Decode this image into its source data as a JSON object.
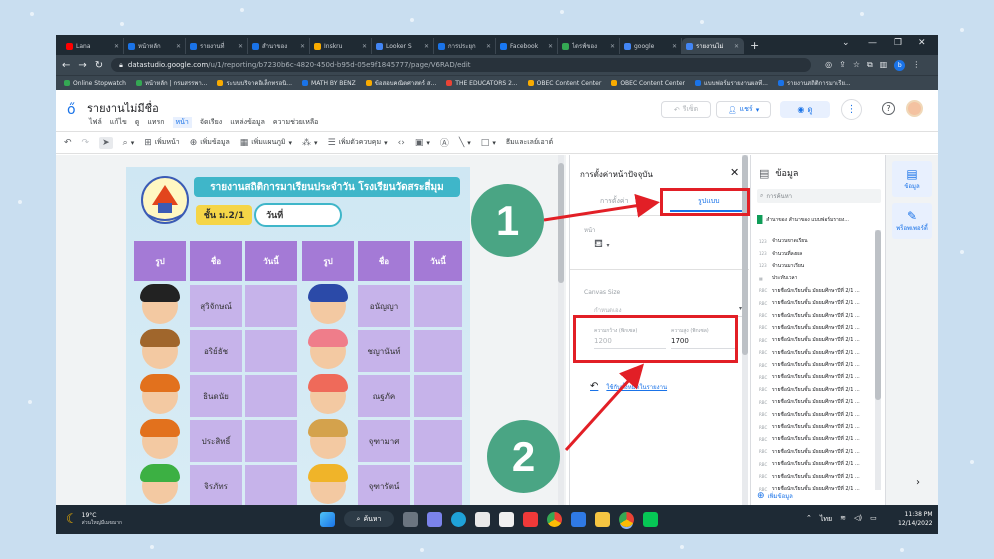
{
  "browser": {
    "tabs": [
      {
        "label": "Lana",
        "color": "#ff0000"
      },
      {
        "label": "หน้าหลัก",
        "color": "#1a73e8"
      },
      {
        "label": "รายงานที่",
        "color": "#1a73e8"
      },
      {
        "label": "สำนาของ",
        "color": "#1a73e8"
      },
      {
        "label": "Inskru",
        "color": "#f9ab00"
      },
      {
        "label": "Looker S",
        "color": "#4285f4"
      },
      {
        "label": "การประยุก",
        "color": "#1a73e8"
      },
      {
        "label": "Facebook",
        "color": "#1877f2"
      },
      {
        "label": "ไดรฟ์ของ",
        "color": "#34a853"
      },
      {
        "label": "google",
        "color": "#4285f4"
      },
      {
        "label": "รายงานไม่",
        "color": "#4285f4",
        "active": true
      }
    ],
    "new_tab": "+",
    "url_domain": "datastudio.google.com",
    "url_path": "/u/1/reporting/b7230b6c-4820-450d-b95d-05e9f1845777/page/V6RAD/edit",
    "profile_initial": "b",
    "bookmarks": [
      {
        "label": "Online Stopwatch",
        "color": "#34a853"
      },
      {
        "label": "หน้าหลัก | กรมสรรพา...",
        "color": "#34a853"
      },
      {
        "label": "ระบบบริจาคอิเล็กทรอนิ...",
        "color": "#f9ab00"
      },
      {
        "label": "MATH BY BENZ",
        "color": "#1a73e8"
      },
      {
        "label": "ข้อสอบคณิตศาสตร์ ส...",
        "color": "#f9ab00"
      },
      {
        "label": "THE EDUCATORS 2...",
        "color": "#ea4335"
      },
      {
        "label": "OBEC Content Center",
        "color": "#f9ab00"
      },
      {
        "label": "OBEC Content Center",
        "color": "#f9ab00"
      },
      {
        "label": "แบบฟอร์มรายงานผลที...",
        "color": "#1a73e8"
      },
      {
        "label": "รายงานสถิติการมาเรีย...",
        "color": "#1a73e8"
      }
    ]
  },
  "app": {
    "title": "รายงานไม่มีชื่อ",
    "menu": [
      "ไฟล์",
      "แก้ไข",
      "ดู",
      "แทรก",
      "หน้า",
      "จัดเรียง",
      "แหล่งข้อมูล",
      "ความช่วยเหลือ"
    ],
    "menu_selected": "หน้า",
    "reset_label": "รีเซ็ต",
    "share_label": "แชร์",
    "view_label": "ดู",
    "toolbar": {
      "add_page": "เพิ่มหน้า",
      "add_data": "เพิ่มข้อมูล",
      "add_chart": "เพิ่มแผนภูมิ",
      "add_control": "เพิ่มตัวควบคุม",
      "theme_layout": "ธีมและเลย์เอาต์"
    }
  },
  "report": {
    "title": "รายงานสถิติการมาเรียนประจำวัน โรงเรียนวัดสระสี่มุม",
    "school_name": "โรงเรียนวัดสระสี่มุม",
    "class_label": "ชั้น ม.2/1",
    "date_label": "วันที่",
    "col_photo": "รูป",
    "col_name": "ชื่อ",
    "col_today": "วันนี้",
    "left_students": [
      "สุวิจักษณ์",
      "อริย์ธัช",
      "ธินดนัย",
      "ประสิทธิ์",
      "จิรภัทร"
    ],
    "right_students": [
      "อนัญญา",
      "ชญานันท์",
      "ณฐภัค",
      "จุฑามาศ",
      "จุฑารัตน์"
    ],
    "left_hair_colors": [
      "#222222",
      "#a0662c",
      "#e2711d",
      "#e2711d",
      "#3cb043"
    ],
    "right_hair_colors": [
      "#2b4aa8",
      "#ef7d8a",
      "#ef6a5a",
      "#d4a24c",
      "#f0b429"
    ]
  },
  "properties": {
    "title": "การตั้งค่าหน้าปัจจุบัน",
    "tab_setup": "การตั้งค่า",
    "tab_style": "รูปแบบ",
    "page_label": "หน้า",
    "canvas_size": "Canvas Size",
    "size_mode": "กำหนดเอง",
    "width_label": "ความกว้าง (พิกเซล)",
    "width_value": "1200",
    "height_label": "ความสูง (พิกเซล)",
    "height_value": "1700",
    "apply_all": "ใช้กับทั้งหมดในรายงาน"
  },
  "data_panel": {
    "title": "ข้อมูล",
    "search_placeholder": "การค้นหา",
    "source": "สำนาของ สำนาของ แบบฟอร์มรายง...",
    "fields": [
      {
        "tag": "123",
        "label": "จำนวนขาดเรียน"
      },
      {
        "tag": "123",
        "label": "จำนวนที่ลงผล"
      },
      {
        "tag": "123",
        "label": "จำนวนมาเรียน"
      },
      {
        "tag": "▦",
        "label": "ประทับเวลา"
      },
      {
        "tag": "RBC",
        "label": "รายชื่อนักเรียนชั้น มัธยมศึกษาปีที่ 2/1 ..."
      },
      {
        "tag": "RBC",
        "label": "รายชื่อนักเรียนชั้น มัธยมศึกษาปีที่ 2/1 ..."
      },
      {
        "tag": "RBC",
        "label": "รายชื่อนักเรียนชั้น มัธยมศึกษาปีที่ 2/1 ..."
      },
      {
        "tag": "RBC",
        "label": "รายชื่อนักเรียนชั้น มัธยมศึกษาปีที่ 2/1 ..."
      },
      {
        "tag": "RBC",
        "label": "รายชื่อนักเรียนชั้น มัธยมศึกษาปีที่ 2/1 ..."
      },
      {
        "tag": "RBC",
        "label": "รายชื่อนักเรียนชั้น มัธยมศึกษาปีที่ 2/1 ..."
      },
      {
        "tag": "RBC",
        "label": "รายชื่อนักเรียนชั้น มัธยมศึกษาปีที่ 2/1 ..."
      },
      {
        "tag": "RBC",
        "label": "รายชื่อนักเรียนชั้น มัธยมศึกษาปีที่ 2/1 ..."
      },
      {
        "tag": "RBC",
        "label": "รายชื่อนักเรียนชั้น มัธยมศึกษาปีที่ 2/1 ..."
      },
      {
        "tag": "RBC",
        "label": "รายชื่อนักเรียนชั้น มัธยมศึกษาปีที่ 2/1 ..."
      },
      {
        "tag": "RBC",
        "label": "รายชื่อนักเรียนชั้น มัธยมศึกษาปีที่ 2/1 ..."
      },
      {
        "tag": "RBC",
        "label": "รายชื่อนักเรียนชั้น มัธยมศึกษาปีที่ 2/1 ..."
      },
      {
        "tag": "RBC",
        "label": "รายชื่อนักเรียนชั้น มัธยมศึกษาปีที่ 2/1 ..."
      },
      {
        "tag": "RBC",
        "label": "รายชื่อนักเรียนชั้น มัธยมศึกษาปีที่ 2/1 ..."
      },
      {
        "tag": "RBC",
        "label": "รายชื่อนักเรียนชั้น มัธยมศึกษาปีที่ 2/1 ..."
      },
      {
        "tag": "RBC",
        "label": "รายชื่อนักเรียนชั้น มัธยมศึกษาปีที่ 2/1 ..."
      },
      {
        "tag": "RBC",
        "label": "รายชื่อนักเรียนชั้น มัธยมศึกษาปีที่ 2/1 ..."
      }
    ],
    "add_data": "เพิ่มข้อมูล"
  },
  "rail": {
    "data_label": "ข้อมูล",
    "properties_label": "พร็อพเพอร์ตี้"
  },
  "taskbar": {
    "temperature": "19°C",
    "weather": "ส่วนใหญ่มีเมฆมาก",
    "search_label": "ค้นหา",
    "language": "ไทย",
    "time": "11:38 PM",
    "date": "12/14/2022"
  },
  "annotations": {
    "badge_1": "1",
    "badge_2": "2",
    "badge_color": "#4aa584",
    "highlight_color": "#e21f26"
  }
}
